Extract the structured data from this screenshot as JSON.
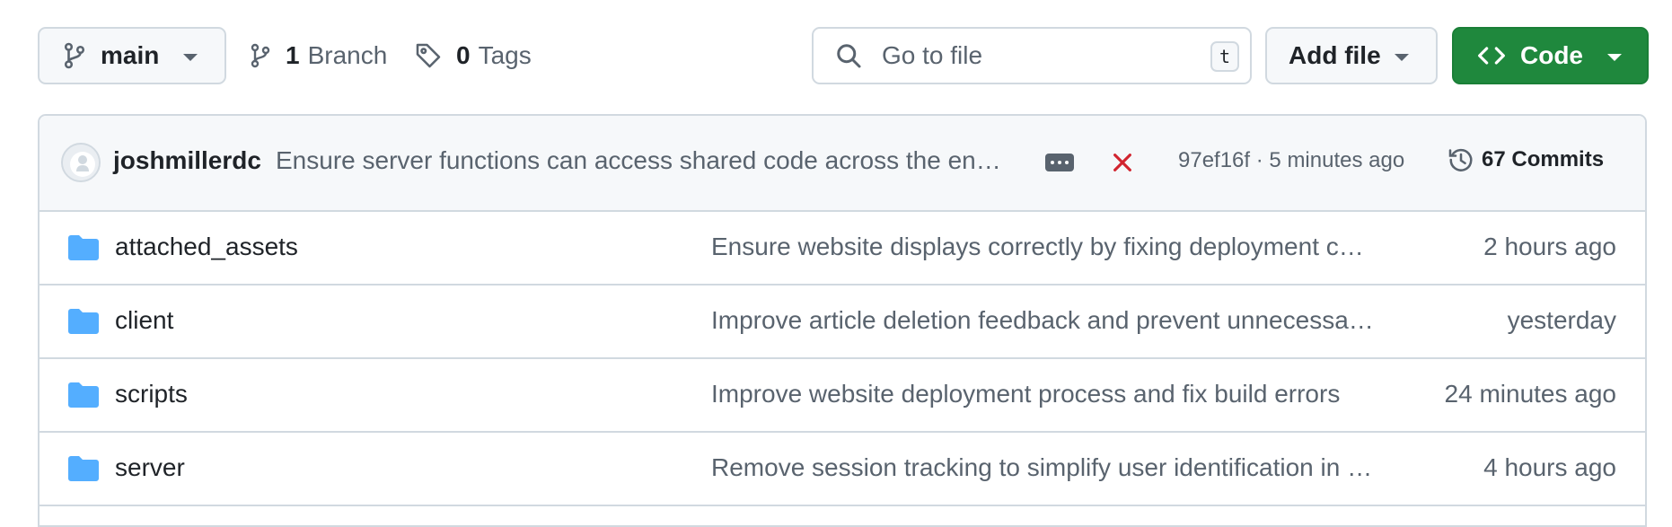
{
  "toolbar": {
    "branch": "main",
    "branches_count": "1",
    "branches_label": "Branch",
    "tags_count": "0",
    "tags_label": "Tags",
    "search_placeholder": "Go to file",
    "search_shortcut": "t",
    "add_file_label": "Add file",
    "code_label": "Code"
  },
  "latest_commit": {
    "author": "joshmillerdc",
    "message": "Ensure server functions can access shared code across the en…",
    "status": "failed",
    "hash": "97ef16f",
    "separator": "·",
    "time": "5 minutes ago",
    "commits_count": "67",
    "commits_label": "Commits"
  },
  "files": [
    {
      "type": "folder",
      "name": "attached_assets",
      "message": "Ensure website displays correctly by fixing deployment c…",
      "time": "2 hours ago"
    },
    {
      "type": "folder",
      "name": "client",
      "message": "Improve article deletion feedback and prevent unnecessa…",
      "time": "yesterday"
    },
    {
      "type": "folder",
      "name": "scripts",
      "message": "Improve website deployment process and fix build errors",
      "time": "24 minutes ago"
    },
    {
      "type": "folder",
      "name": "server",
      "message": "Remove session tracking to simplify user identification in …",
      "time": "4 hours ago"
    }
  ],
  "colors": {
    "primary_button": "#1f883d",
    "folder": "#54aeff",
    "fail": "#d1242f",
    "muted_text": "#59636e",
    "border": "#d1d9e0"
  }
}
